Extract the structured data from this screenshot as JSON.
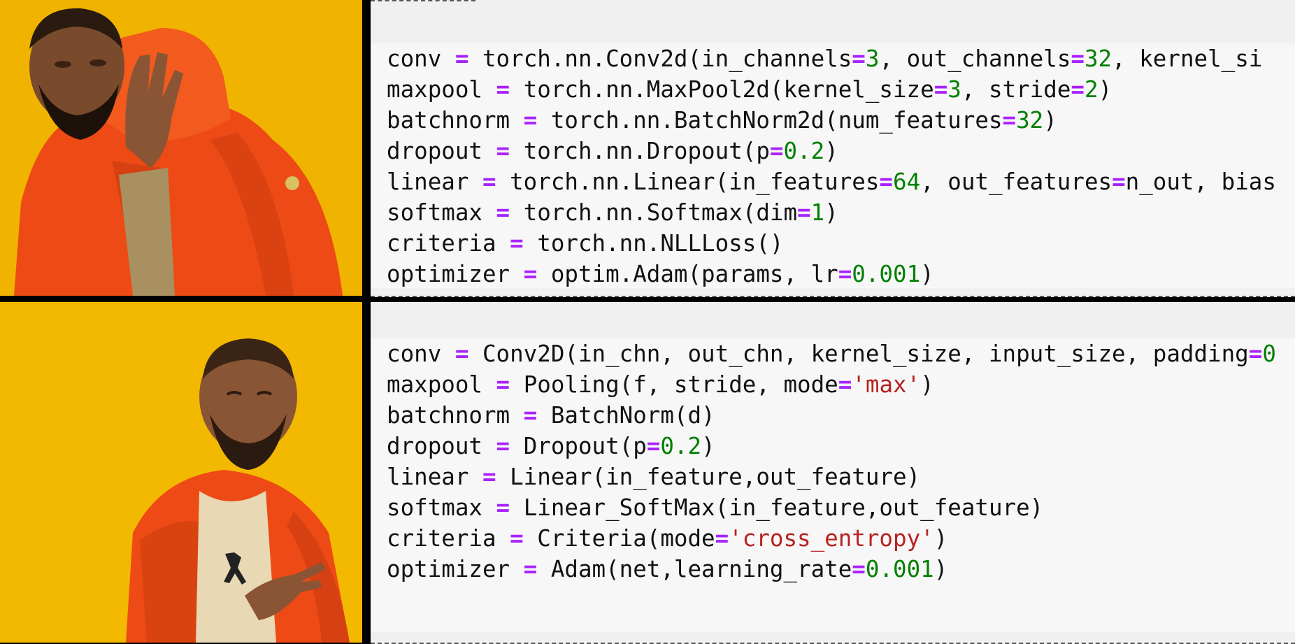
{
  "top_code": [
    [
      [
        "conv ",
        "t"
      ],
      [
        "=",
        "o"
      ],
      [
        " torch.nn.Conv2d(in_channels",
        "t"
      ],
      [
        "=",
        "o"
      ],
      [
        "3",
        "n"
      ],
      [
        ", out_channels",
        "t"
      ],
      [
        "=",
        "o"
      ],
      [
        "32",
        "n"
      ],
      [
        ", kernel_si",
        "t"
      ]
    ],
    [
      [
        "maxpool ",
        "t"
      ],
      [
        "=",
        "o"
      ],
      [
        " torch.nn.MaxPool2d(kernel_size",
        "t"
      ],
      [
        "=",
        "o"
      ],
      [
        "3",
        "n"
      ],
      [
        ", stride",
        "t"
      ],
      [
        "=",
        "o"
      ],
      [
        "2",
        "n"
      ],
      [
        ")",
        "t"
      ]
    ],
    [
      [
        "batchnorm ",
        "t"
      ],
      [
        "=",
        "o"
      ],
      [
        " torch.nn.BatchNorm2d(num_features",
        "t"
      ],
      [
        "=",
        "o"
      ],
      [
        "32",
        "n"
      ],
      [
        ")",
        "t"
      ]
    ],
    [
      [
        "dropout ",
        "t"
      ],
      [
        "=",
        "o"
      ],
      [
        " torch.nn.Dropout(p",
        "t"
      ],
      [
        "=",
        "o"
      ],
      [
        "0.2",
        "n"
      ],
      [
        ")",
        "t"
      ]
    ],
    [
      [
        "linear ",
        "t"
      ],
      [
        "=",
        "o"
      ],
      [
        " torch.nn.Linear(in_features",
        "t"
      ],
      [
        "=",
        "o"
      ],
      [
        "64",
        "n"
      ],
      [
        ", out_features",
        "t"
      ],
      [
        "=",
        "o"
      ],
      [
        "n_out, bias",
        "t"
      ]
    ],
    [
      [
        "softmax ",
        "t"
      ],
      [
        "=",
        "o"
      ],
      [
        " torch.nn.Softmax(dim",
        "t"
      ],
      [
        "=",
        "o"
      ],
      [
        "1",
        "n"
      ],
      [
        ")",
        "t"
      ]
    ],
    [
      [
        "criteria ",
        "t"
      ],
      [
        "=",
        "o"
      ],
      [
        " torch.nn.NLLLoss()",
        "t"
      ]
    ],
    [
      [
        "optimizer ",
        "t"
      ],
      [
        "=",
        "o"
      ],
      [
        " optim.Adam(params, lr",
        "t"
      ],
      [
        "=",
        "o"
      ],
      [
        "0.001",
        "n"
      ],
      [
        ")",
        "t"
      ]
    ]
  ],
  "bottom_code": [
    [
      [
        "conv ",
        "t"
      ],
      [
        "=",
        "o"
      ],
      [
        " Conv2D(in_chn, out_chn, kernel_size, input_size, padding",
        "t"
      ],
      [
        "=",
        "o"
      ],
      [
        "0",
        "n"
      ]
    ],
    [
      [
        "maxpool ",
        "t"
      ],
      [
        "=",
        "o"
      ],
      [
        " Pooling(f, stride, mode",
        "t"
      ],
      [
        "=",
        "o"
      ],
      [
        "'max'",
        "s"
      ],
      [
        ")",
        "t"
      ]
    ],
    [
      [
        "batchnorm ",
        "t"
      ],
      [
        "=",
        "o"
      ],
      [
        " BatchNorm(d)",
        "t"
      ]
    ],
    [
      [
        "dropout ",
        "t"
      ],
      [
        "=",
        "o"
      ],
      [
        " Dropout(p",
        "t"
      ],
      [
        "=",
        "o"
      ],
      [
        "0.2",
        "n"
      ],
      [
        ")",
        "t"
      ]
    ],
    [
      [
        "linear ",
        "t"
      ],
      [
        "=",
        "o"
      ],
      [
        " Linear(in_feature,out_feature)",
        "t"
      ]
    ],
    [
      [
        "softmax ",
        "t"
      ],
      [
        "=",
        "o"
      ],
      [
        " Linear_SoftMax(in_feature,out_feature)",
        "t"
      ]
    ],
    [
      [
        "criteria ",
        "t"
      ],
      [
        "=",
        "o"
      ],
      [
        " Criteria(mode",
        "t"
      ],
      [
        "=",
        "o"
      ],
      [
        "'cross_entropy'",
        "s"
      ],
      [
        ")",
        "t"
      ]
    ],
    [
      [
        "optimizer ",
        "t"
      ],
      [
        "=",
        "o"
      ],
      [
        " Adam(net,learning_rate",
        "t"
      ],
      [
        "=",
        "o"
      ],
      [
        "0.001",
        "n"
      ],
      [
        ")",
        "t"
      ]
    ]
  ],
  "colors": {
    "background": "#f3b800",
    "jacket": "#ee4a15",
    "operator": "#aa22ff",
    "number": "#008000",
    "string": "#ba2121",
    "code_bg": "#f7f7f7",
    "panel_bg": "#f0f0f0",
    "divider": "#000000"
  },
  "panels": {
    "top_image": "drake-disapproving",
    "bottom_image": "drake-approving"
  }
}
